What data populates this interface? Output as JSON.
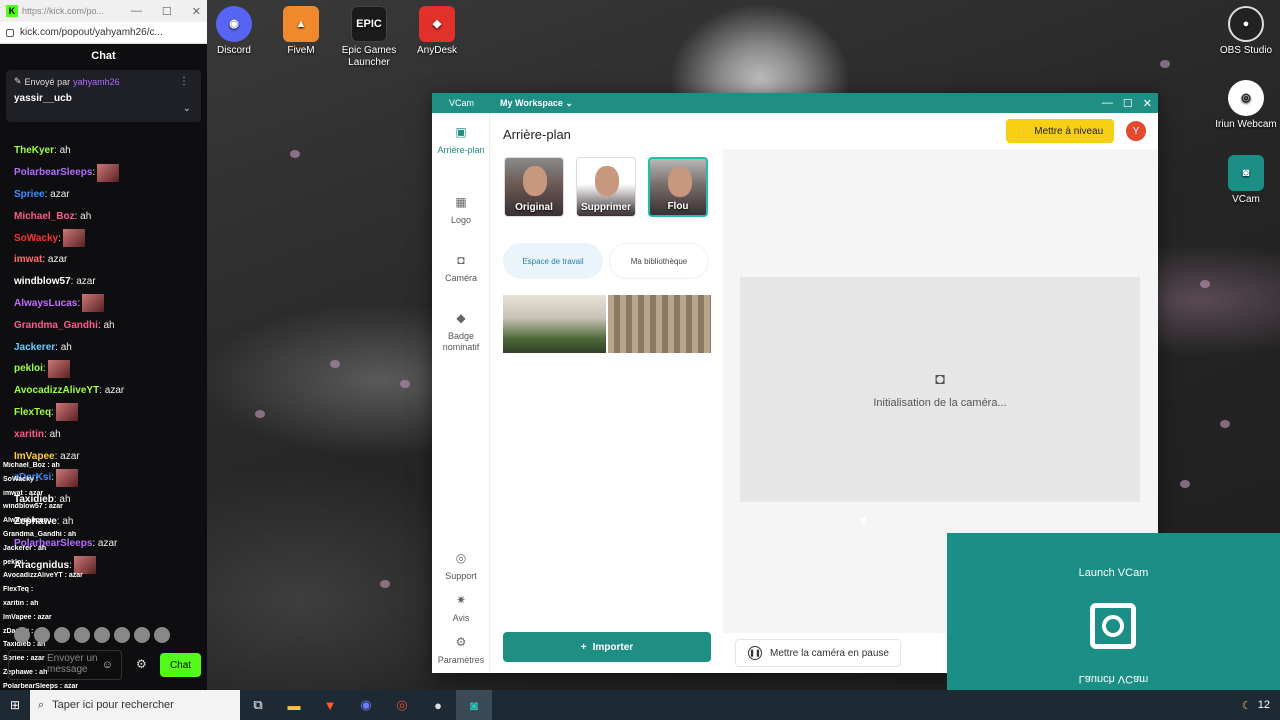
{
  "desktop_icons": [
    {
      "label": "Discord",
      "color": "#5865f2",
      "icon": "discord-icon"
    },
    {
      "label": "FiveM",
      "color": "#f0892b",
      "icon": "fivem-icon"
    },
    {
      "label": "Epic Games Launcher",
      "color": "#1a1a1a",
      "icon": "epic-games-icon"
    },
    {
      "label": "AnyDesk",
      "color": "#e2302b",
      "icon": "anydesk-icon"
    },
    {
      "label": "OBS Studio",
      "icon": "obs-icon"
    },
    {
      "label": "Iriun Webcam",
      "icon": "iriun-icon"
    },
    {
      "label": "VCam",
      "icon": "vcam-icon"
    }
  ],
  "browser": {
    "url_tab": "https://kick.com/po...",
    "url": "kick.com/popout/yahyamh26/c...",
    "chat_title": "Chat",
    "pinned": {
      "prefix": "Envoyé par",
      "sender": "yahyamh26",
      "username": "yassir__ucb"
    },
    "messages": [
      {
        "user": "TheKyer",
        "text": ": ah",
        "color": "#9cff3a",
        "emote": false
      },
      {
        "user": "PolarbearSleeps",
        "text": ":",
        "color": "#b36cff",
        "emote": true
      },
      {
        "user": "Spriee",
        "text": ": azar",
        "color": "#3e8fff",
        "emote": false
      },
      {
        "user": "Michael_Boz",
        "text": ": ah",
        "color": "#ff5c8a",
        "emote": false
      },
      {
        "user": "SoWacky",
        "text": ":",
        "color": "#ff3030",
        "emote": true
      },
      {
        "user": "imwat",
        "text": ": azar",
        "color": "#ff6b6b",
        "emote": false
      },
      {
        "user": "windblow57",
        "text": ": azar",
        "color": "#ffffff",
        "emote": false
      },
      {
        "user": "AlwaysLucas",
        "text": ":",
        "color": "#c76cff",
        "emote": true
      },
      {
        "user": "Grandma_Gandhi",
        "text": ": ah",
        "color": "#ff5c8a",
        "emote": false
      },
      {
        "user": "Jackerer",
        "text": ": ah",
        "color": "#63d0ff",
        "emote": false
      },
      {
        "user": "pekloi",
        "text": ":",
        "color": "#9cff3a",
        "emote": true
      },
      {
        "user": "AvocadizzAliveYT",
        "text": ": azar",
        "color": "#9cff3a",
        "emote": false
      },
      {
        "user": "FlexTeq",
        "text": ":",
        "color": "#9cff3a",
        "emote": true
      },
      {
        "user": "xaritin",
        "text": ": ah",
        "color": "#ff5c8a",
        "emote": false
      },
      {
        "user": "ImVapee",
        "text": ": azar",
        "color": "#ffcc33",
        "emote": false
      },
      {
        "user": "zDarKsi",
        "text": ":",
        "color": "#3e8fff",
        "emote": true
      },
      {
        "user": "Taxidieb",
        "text": ": ah",
        "color": "#ffffff",
        "emote": false
      },
      {
        "user": "Zephawe",
        "text": ": ah",
        "color": "#ffffff",
        "emote": false
      },
      {
        "user": "PolarbearSleeps",
        "text": ": azar",
        "color": "#b36cff",
        "emote": false
      },
      {
        "user": "Aracgnidus",
        "text": ":",
        "color": "#ffffff",
        "emote": true
      }
    ],
    "overlay_messages": [
      "Michael_Boz : ah",
      "SoWacky :",
      "imwat : azar",
      "windblow57 : azar",
      "AlwaysLucas :",
      "Grandma_Gandhi : ah",
      "Jackerer : ah",
      "pekloi :",
      "AvocadizzAliveYT : azar",
      "FlexTeq :",
      "xaritin : ah",
      "ImVapee : azar",
      "zDarKsi :",
      "Taxidieb : ah",
      "Spriee : azar",
      "Zephawe : ah",
      "PolarbearSleeps : azar",
      "Aracgnidus :"
    ],
    "input_placeholder": "Envoyer un message",
    "chat_button": "Chat"
  },
  "vcam": {
    "app_name": "VCam",
    "workspace": "My Workspace",
    "nav": [
      {
        "label": "Arrière-plan",
        "icon": "image-icon",
        "active": true
      },
      {
        "label": "Logo",
        "icon": "logo-icon",
        "active": false
      },
      {
        "label": "Caméra",
        "icon": "camera-icon",
        "active": false
      },
      {
        "label": "Badge nominatif",
        "icon": "tag-icon",
        "active": false
      },
      {
        "label": "Support",
        "icon": "support-icon",
        "active": false
      },
      {
        "label": "Avis",
        "icon": "bulb-icon",
        "active": false
      },
      {
        "label": "Paramètres",
        "icon": "gear-icon",
        "active": false
      }
    ],
    "section_title": "Arrière-plan",
    "bg_options": [
      {
        "label": "Original",
        "selected": false
      },
      {
        "label": "Supprimer",
        "selected": false
      },
      {
        "label": "Flou",
        "selected": true
      }
    ],
    "tabs": [
      {
        "label": "Espace de travail",
        "active": true
      },
      {
        "label": "Ma bibliothèque",
        "active": false
      }
    ],
    "import_label": "Importer",
    "upgrade_label": "Mettre à niveau",
    "avatar_initial": "Y",
    "status": "Initialisation de la caméra...",
    "pause_label": "Mettre la caméra en pause",
    "accent": "#1f8f85"
  },
  "launch_panel": {
    "title": "Launch VCam",
    "mirrored": "Launch VCam"
  },
  "taskbar": {
    "search_placeholder": "Taper ici pour rechercher",
    "clock": "12"
  }
}
